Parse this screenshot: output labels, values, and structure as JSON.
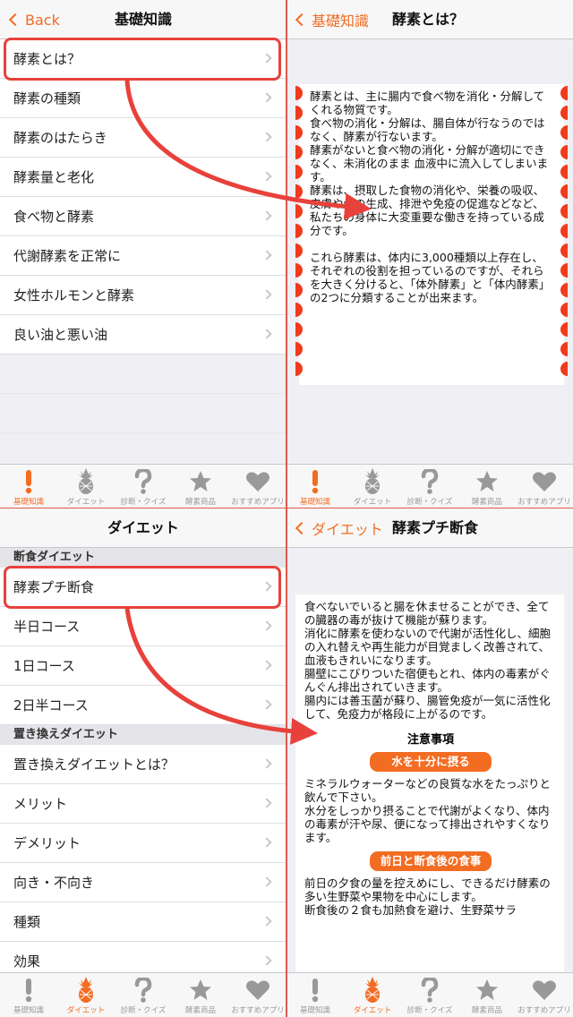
{
  "colors": {
    "accent": "#f26c22",
    "highlight": "#e8413b"
  },
  "panel1": {
    "back_label": "Back",
    "title": "基礎知識",
    "items": [
      "酵素とは？",
      "酵素の種類",
      "酵素のはたらき",
      "酵素量と老化",
      "食べ物と酵素",
      "代謝酵素を正常に",
      "女性ホルモンと酵素",
      "良い油と悪い油"
    ]
  },
  "panel2": {
    "back_label": "基礎知識",
    "title": "酵素とは？",
    "paragraph1": "酵素とは、主に腸内で食べ物を消化・分解してくれる物質です。\n食べ物の消化・分解は、腸自体が行なうのではなく、酵素が行ないます。\n酵素がないと食べ物の消化・分解が適切にできなく、未消化のまま 血液中に流入してしまいます。\n酵素は、摂取した食物の消化や、栄養の吸収、皮膚や骨の生成、排泄や免疫の促進などなど、私たちの身体に大変重要な働きを持っている成分です。",
    "paragraph2": "これら酵素は、体内に3,000種類以上存在し、それぞれの役割を担っているのですが、それらを大きく分けると、「体外酵素」と「体内酵素」の2つに分類することが出来ます。"
  },
  "panel3": {
    "title": "ダイエット",
    "section1": "断食ダイエット",
    "items1": [
      "酵素プチ断食",
      "半日コース",
      "1日コース",
      "2日半コース"
    ],
    "section2": "置き換えダイエット",
    "items2": [
      "置き換えダイエットとは？",
      "メリット",
      "デメリット",
      "向き・不向き",
      "種類",
      "効果"
    ]
  },
  "panel4": {
    "back_label": "ダイエット",
    "title": "酵素プチ断食",
    "intro": "食べないでいると腸を休ませることができ、全ての臓器の毒が抜けて機能が蘇ります。\n消化に酵素を使わないので代謝が活性化し、細胞の入れ替えや再生能力が目覚ましく改善されて、血液もきれいになります。\n腸壁にこびりついた宿便もとれ、体内の毒素がぐんぐん排出されていきます。\n腸内には善玉菌が蘇り、腸管免疫が一気に活性化して、免疫力が格段に上がるのです。",
    "caution_title": "注意事項",
    "pill1": "水を十分に摂る",
    "text1": "ミネラルウォーターなどの良質な水をたっぷりと飲んで下さい。\n水分をしっかり摂ることで代謝がよくなり、体内の毒素が汗や尿、便になって排出されやすくなります。",
    "pill2": "前日と断食後の食事",
    "text2": "前日の夕食の量を控えめにし、できるだけ酵素の多い生野菜や果物を中心にします。\n断食後の２食も加熱食を避け、生野菜サラ"
  },
  "tabbar": {
    "tabs": [
      "基礎知識",
      "ダイエット",
      "診断・クイズ",
      "酵素商品",
      "おすすめアプリ"
    ]
  }
}
